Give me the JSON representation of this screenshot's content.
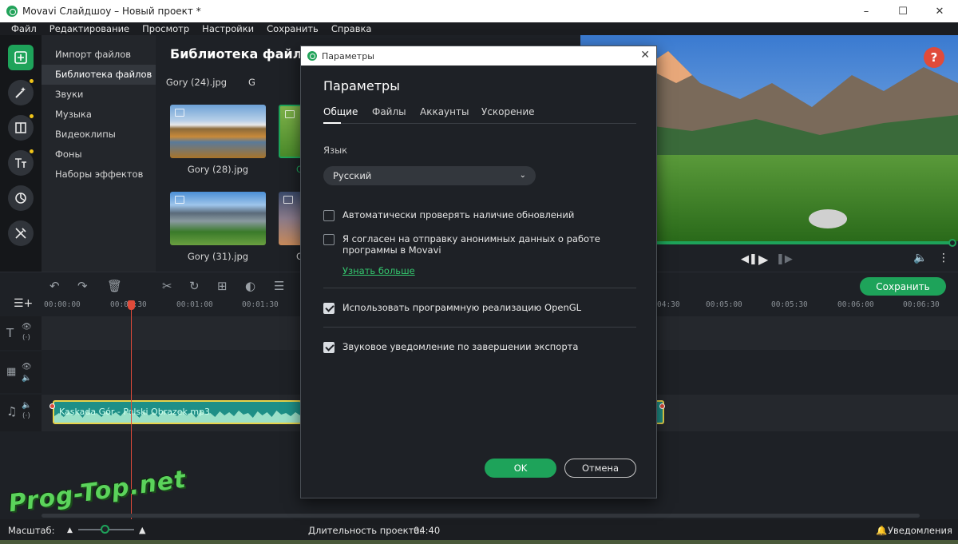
{
  "app": {
    "title": "Movavi Слайдшоу – Новый проект *",
    "menu": [
      "Файл",
      "Редактирование",
      "Просмотр",
      "Настройки",
      "Сохранить",
      "Справка"
    ]
  },
  "sidebar": {
    "categories": [
      {
        "label": "Импорт файлов"
      },
      {
        "label": "Библиотека файлов",
        "active": true
      },
      {
        "label": "Звуки"
      },
      {
        "label": "Музыка"
      },
      {
        "label": "Видеоклипы"
      },
      {
        "label": "Фоны"
      },
      {
        "label": "Наборы эффектов"
      }
    ],
    "tools": [
      "import-icon",
      "magic-wand-icon",
      "transition-icon",
      "text-icon",
      "filter-icon",
      "tools-icon"
    ]
  },
  "library": {
    "title": "Библиотека файлов",
    "items": [
      {
        "label": "Gory (24).jpg"
      },
      {
        "label": "Gory (28).jpg"
      },
      {
        "label": "Gory (31).jpg"
      },
      {
        "label": "G"
      },
      {
        "label": "G"
      },
      {
        "label": "G"
      }
    ]
  },
  "preview": {
    "help": "?"
  },
  "timeline": {
    "save_label": "Сохранить",
    "ruler": [
      "00:00:00",
      "00:00:30",
      "00:01:00",
      "00:01:30",
      "04:30",
      "00:05:00",
      "00:05:30",
      "00:06:00",
      "00:06:30"
    ],
    "audio_clip_label": "Kaskada Gór - Polski Obrazek.mp3"
  },
  "status": {
    "zoom_label": "Масштаб:",
    "duration_label": "Длительность проекта:",
    "duration_value": "04:40",
    "notifications": "Уведомления"
  },
  "watermark": "Prog-Top.net",
  "dialog": {
    "caption": "Параметры",
    "heading": "Параметры",
    "tabs": [
      "Общие",
      "Файлы",
      "Аккаунты",
      "Ускорение"
    ],
    "language_label": "Язык",
    "language_value": "Русский",
    "checks": [
      {
        "label": "Автоматически проверять наличие обновлений",
        "checked": false
      },
      {
        "label": "Я согласен на отправку анонимных данных о работе программы в Movavi",
        "checked": false
      },
      {
        "label": "Использовать программную реализацию OpenGL",
        "checked": true
      },
      {
        "label": "Звуковое уведомление по завершении экспорта",
        "checked": true
      }
    ],
    "learn_more": "Узнать больше",
    "ok": "OK",
    "cancel": "Отмена"
  },
  "colors": {
    "accent": "#1ea35a",
    "playhead": "#e04b3a",
    "clip_border": "#e8d34a"
  }
}
